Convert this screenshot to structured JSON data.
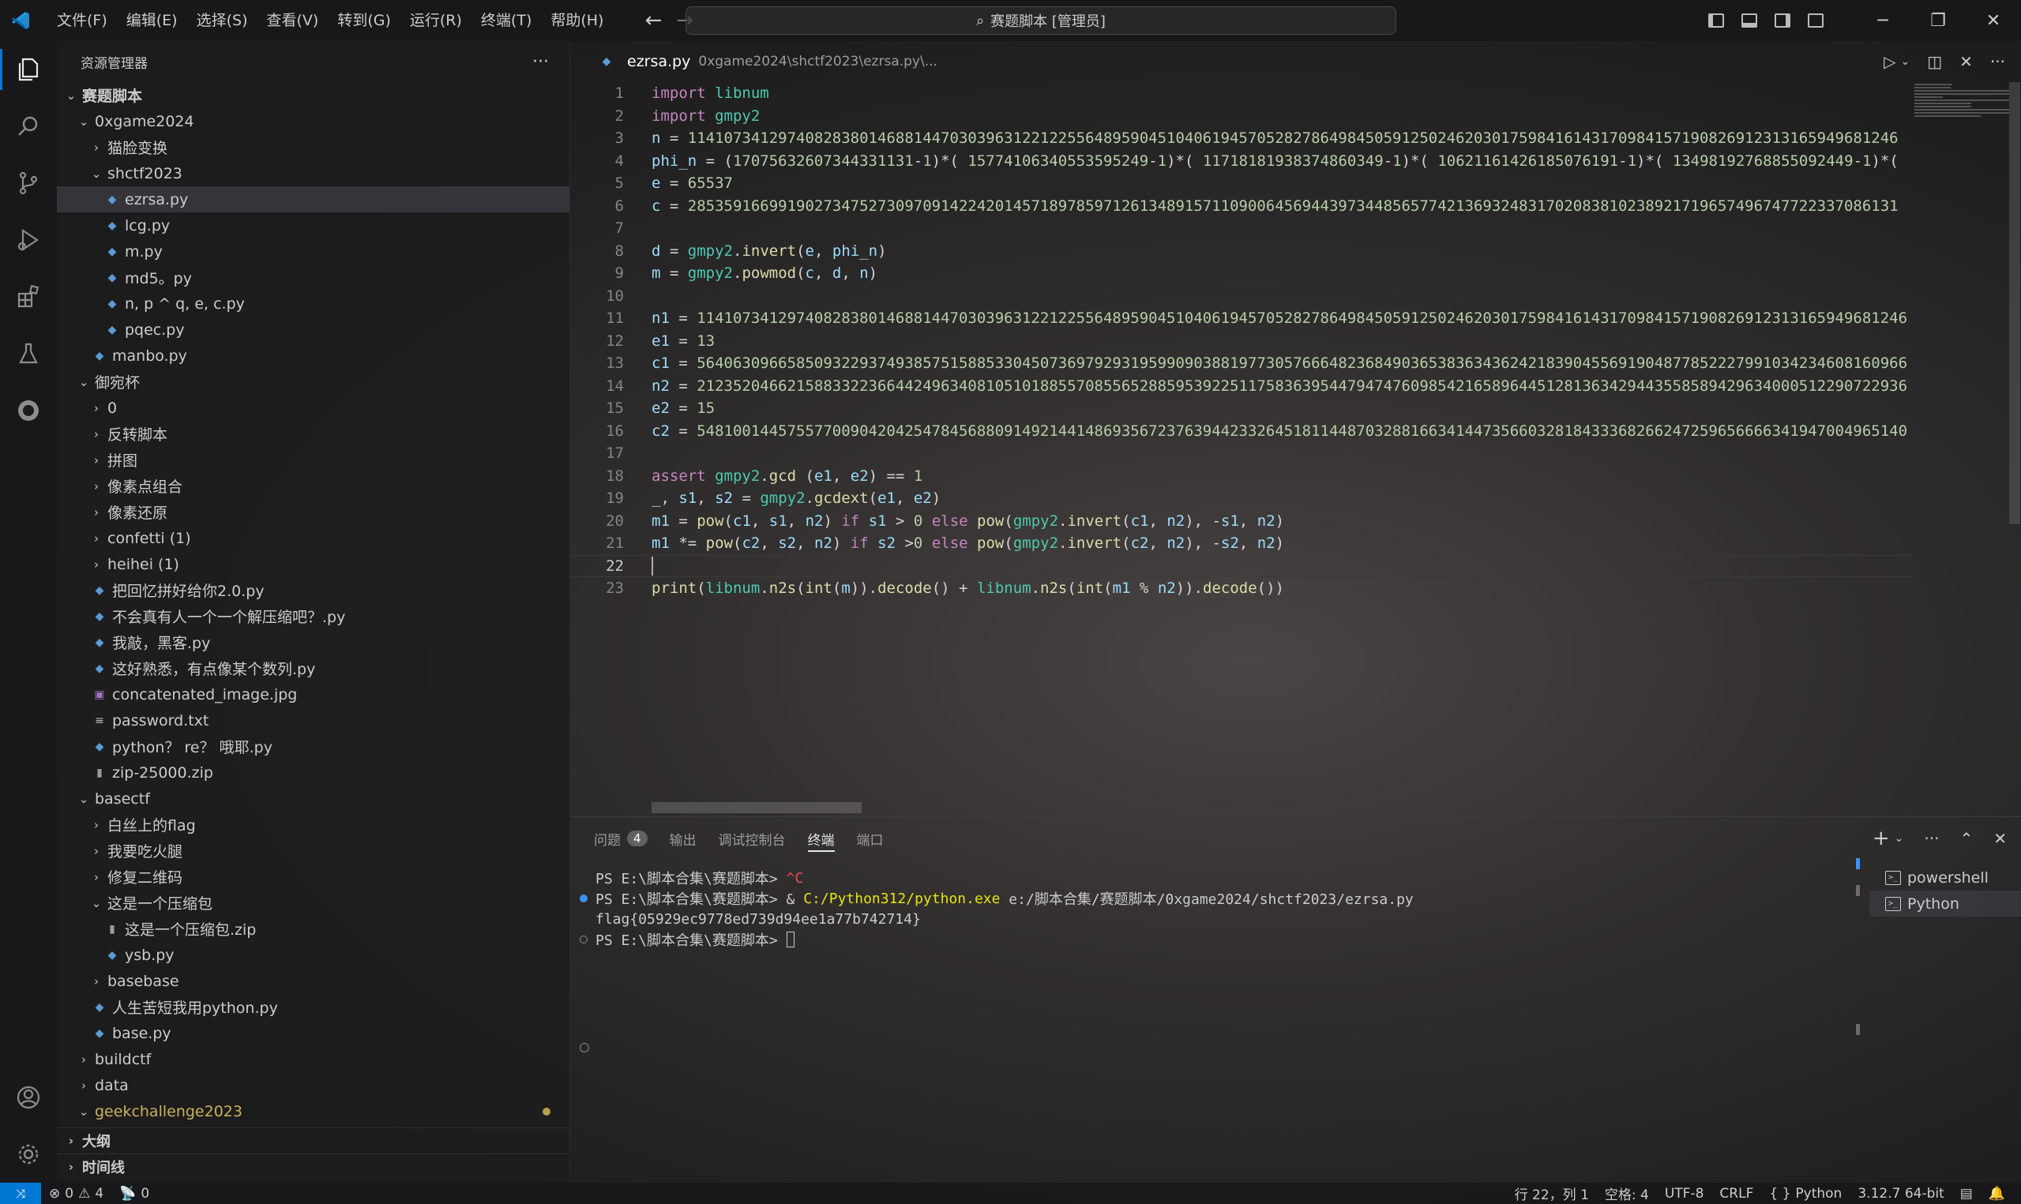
{
  "titlebar": {
    "menu": [
      "文件(F)",
      "编辑(E)",
      "选择(S)",
      "查看(V)",
      "转到(G)",
      "运行(R)",
      "终端(T)",
      "帮助(H)"
    ],
    "search_text": "赛题脚本 [管理员]"
  },
  "sidebar": {
    "title": "资源管理器",
    "more": "···",
    "root": "赛题脚本",
    "items": [
      {
        "label": "0xgame2024",
        "depth": 1,
        "kind": "folder-open"
      },
      {
        "label": "猫脸变换",
        "depth": 2,
        "kind": "folder"
      },
      {
        "label": "shctf2023",
        "depth": 2,
        "kind": "folder-open"
      },
      {
        "label": "ezrsa.py",
        "depth": 3,
        "kind": "py",
        "selected": true
      },
      {
        "label": "lcg.py",
        "depth": 3,
        "kind": "py"
      },
      {
        "label": "m.py",
        "depth": 3,
        "kind": "py"
      },
      {
        "label": "md5。py",
        "depth": 3,
        "kind": "py"
      },
      {
        "label": "n, p ^ q, e, c.py",
        "depth": 3,
        "kind": "py"
      },
      {
        "label": "pqec.py",
        "depth": 3,
        "kind": "py"
      },
      {
        "label": "manbo.py",
        "depth": 2,
        "kind": "py"
      },
      {
        "label": "御宛杯",
        "depth": 1,
        "kind": "folder-open"
      },
      {
        "label": "0",
        "depth": 2,
        "kind": "folder"
      },
      {
        "label": "反转脚本",
        "depth": 2,
        "kind": "folder"
      },
      {
        "label": "拼图",
        "depth": 2,
        "kind": "folder"
      },
      {
        "label": "像素点组合",
        "depth": 2,
        "kind": "folder"
      },
      {
        "label": "像素还原",
        "depth": 2,
        "kind": "folder"
      },
      {
        "label": "confetti (1)",
        "depth": 2,
        "kind": "folder"
      },
      {
        "label": "heihei (1)",
        "depth": 2,
        "kind": "folder"
      },
      {
        "label": "把回忆拼好给你2.0.py",
        "depth": 2,
        "kind": "py"
      },
      {
        "label": "不会真有人一个一个解压缩吧？.py",
        "depth": 2,
        "kind": "py"
      },
      {
        "label": "我敲，黑客.py",
        "depth": 2,
        "kind": "py"
      },
      {
        "label": "这好熟悉，有点像某个数列.py",
        "depth": 2,
        "kind": "py"
      },
      {
        "label": "concatenated_image.jpg",
        "depth": 2,
        "kind": "img"
      },
      {
        "label": "password.txt",
        "depth": 2,
        "kind": "txt"
      },
      {
        "label": "python？ re？ 哦耶.py",
        "depth": 2,
        "kind": "py"
      },
      {
        "label": "zip-25000.zip",
        "depth": 2,
        "kind": "zip"
      },
      {
        "label": "basectf",
        "depth": 1,
        "kind": "folder-open"
      },
      {
        "label": "白丝上的flag",
        "depth": 2,
        "kind": "folder"
      },
      {
        "label": "我要吃火腿",
        "depth": 2,
        "kind": "folder"
      },
      {
        "label": "修复二维码",
        "depth": 2,
        "kind": "folder"
      },
      {
        "label": "这是一个压缩包",
        "depth": 2,
        "kind": "folder-open"
      },
      {
        "label": "这是一个压缩包.zip",
        "depth": 3,
        "kind": "zip"
      },
      {
        "label": "ysb.py",
        "depth": 3,
        "kind": "py"
      },
      {
        "label": "basebase",
        "depth": 2,
        "kind": "folder"
      },
      {
        "label": "人生苦短我用python.py",
        "depth": 2,
        "kind": "py"
      },
      {
        "label": "base.py",
        "depth": 2,
        "kind": "py"
      },
      {
        "label": "buildctf",
        "depth": 1,
        "kind": "folder"
      },
      {
        "label": "data",
        "depth": 1,
        "kind": "folder"
      },
      {
        "label": "geekchallenge2023",
        "depth": 1,
        "kind": "folder-open",
        "modified": true
      }
    ],
    "outline": "大纲",
    "timeline": "时间线"
  },
  "tab": {
    "file": "ezrsa.py",
    "path": "0xgame2024\\shctf2023\\ezrsa.py\\..."
  },
  "editor": {
    "current_line": 22,
    "lines": [
      "import libnum",
      "import gmpy2",
      "n = 11410734129740828380146881447030396312212255648959045104061945705282786498450591250246203017598416143170984157190826912313165949681246",
      "phi_n = (17075632607344331131-1)*( 15774106340553595249-1)*( 11718181938374860349-1)*( 10621161426185076191-1)*( 13498192768855092449-1)*(",
      "e = 65537",
      "c = 28535916699190273475273097091422420145718978597126134891571109006456944397344856577421369324831702083810238921719657496747722337086131",
      "",
      "d = gmpy2.invert(e, phi_n)",
      "m = gmpy2.powmod(c, d, n)",
      "",
      "n1 = 11410734129740828380146881447030396312212255648959045104061945705282786498450591250246203017598416143170984157190826912313165949681246",
      "e1 = 13",
      "c1 = 56406309665850932293749385751588533045073697929319599090388197730576664823684903653836343624218390455691904877852227991034234608160966",
      "n2 = 21235204662158833223664424963408105101885570855652885953922511758363954479474760985421658964451281363429443558589429634000512290722936",
      "e2 = 15",
      "c2 = 54810014457557700904204254784568809149214414869356723763944233264518114487032881663414473566032818433368266247259656666341947004965140",
      "",
      "assert gmpy2.gcd (e1, e2) == 1",
      "_, s1, s2 = gmpy2.gcdext(e1, e2)",
      "m1 = pow(c1, s1, n2) if s1 > 0 else pow(gmpy2.invert(c1, n2), -s1, n2)",
      "m1 *= pow(c2, s2, n2) if s2 >0 else pow(gmpy2.invert(c2, n2), -s2, n2)",
      "",
      "print(libnum.n2s(int(m)).decode() + libnum.n2s(int(m1 % n2)).decode())"
    ]
  },
  "panel": {
    "tabs": [
      {
        "label": "问题",
        "badge": "4"
      },
      {
        "label": "输出"
      },
      {
        "label": "调试控制台"
      },
      {
        "label": "终端",
        "active": true
      },
      {
        "label": "端口"
      }
    ],
    "terminal": {
      "line1_prompt": "PS E:\\脚本合集\\赛题脚本> ",
      "line1_cmd": "^C",
      "line2_prompt": "PS E:\\脚本合集\\赛题脚本> & ",
      "line2_exe": "C:/Python312/python.exe",
      "line2_arg": " e:/脚本合集/赛题脚本/0xgame2024/shctf2023/ezrsa.py",
      "line3": "flag{05929ec9778ed739d94ee1a77b742714}",
      "line4_prompt": "PS E:\\脚本合集\\赛题脚本> "
    },
    "terminal_list": [
      "powershell",
      "Python"
    ]
  },
  "statusbar": {
    "errors": "0",
    "warnings": "4",
    "ports": "0",
    "position": "行 22，列 1",
    "spaces": "空格: 4",
    "encoding": "UTF-8",
    "eol": "CRLF",
    "language": "Python",
    "interpreter": "3.12.7 64-bit"
  }
}
